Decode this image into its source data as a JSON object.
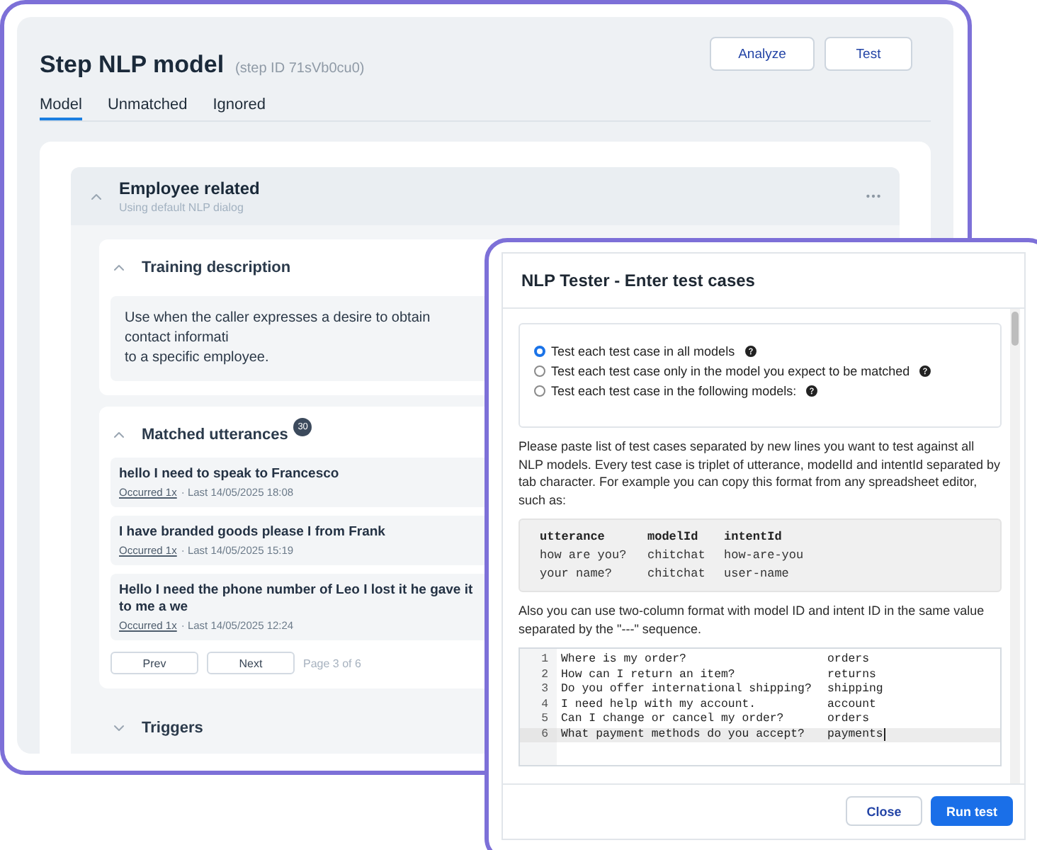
{
  "main_window": {
    "title": "Step NLP model",
    "step_id": "(step ID 71sVb0cu0)",
    "buttons": [
      "Analyze",
      "Test"
    ],
    "tabs": [
      {
        "label": "Model",
        "selected": true
      },
      {
        "label": "Unmatched",
        "selected": false
      },
      {
        "label": "Ignored",
        "selected": false
      }
    ],
    "model": {
      "name": "Employee related",
      "subtitle": "Using default NLP dialog",
      "expanded": true,
      "sections": [
        {
          "kind": "description",
          "title": "Training description",
          "expanded": true,
          "lines": [
            "Use when the caller expresses a desire to obtain contact informati",
            "to a specific employee."
          ]
        },
        {
          "kind": "utterances",
          "title": "Matched utterances",
          "expanded": true,
          "count": "30",
          "items": [
            {
              "text": "hello I need to speak to Francesco",
              "occurred": "Occurred 1x",
              "last": "· Last 14/05/2025 18:08"
            },
            {
              "text": "I have branded goods please I from Frank",
              "occurred": "Occurred 1x",
              "last": "· Last 14/05/2025 15:19"
            },
            {
              "text": "Hello I need the phone number of Leo I lost it he gave it to me a we",
              "occurred": "Occurred 1x",
              "last": "· Last 14/05/2025 12:24"
            }
          ],
          "pagination": {
            "prev": "Prev",
            "next": "Next",
            "page": "Page 3 of 6"
          }
        },
        {
          "kind": "triggers",
          "title": "Triggers",
          "expanded": false
        }
      ]
    }
  },
  "dialog": {
    "title": "NLP Tester - Enter test cases",
    "options": [
      {
        "label": "Test each test case in all models",
        "selected": true
      },
      {
        "label": "Test each test case only in the model you expect to be matched",
        "selected": false
      },
      {
        "label": "Test each test case in the following models:",
        "selected": false
      }
    ],
    "intro": "Please paste list of test cases separated by new lines you want to test against all NLP models. Every test case is triplet of utterance, modelId and intentId separated by tab character. For example you can copy this format from any spreadsheet editor, such as:",
    "example": {
      "columns": [
        "utterance",
        "modelId",
        "intentId"
      ],
      "rows": [
        [
          "how are you?",
          "chitchat",
          "how-are-you"
        ],
        [
          "your name?",
          "chitchat",
          "user-name"
        ]
      ]
    },
    "note": "Also you can use two-column format with model ID and intent ID in the same value separated by the \"---\" sequence.",
    "editor": {
      "lines": [
        {
          "number": "1",
          "utterance": "Where is my order?",
          "intent": "orders",
          "current": false
        },
        {
          "number": "2",
          "utterance": "How can I return an item?",
          "intent": "returns",
          "current": false
        },
        {
          "number": "3",
          "utterance": "Do you offer international shipping?",
          "intent": "shipping",
          "current": false
        },
        {
          "number": "4",
          "utterance": "I need help with my account.",
          "intent": "account",
          "current": false
        },
        {
          "number": "5",
          "utterance": "Can I change or cancel my order?",
          "intent": "orders",
          "current": false
        },
        {
          "number": "6",
          "utterance": "What payment methods do you accept?",
          "intent": "payments",
          "current": true
        }
      ]
    },
    "buttons": [
      {
        "label": "Close",
        "kind": "secondary"
      },
      {
        "label": "Run test",
        "kind": "primary"
      }
    ]
  }
}
